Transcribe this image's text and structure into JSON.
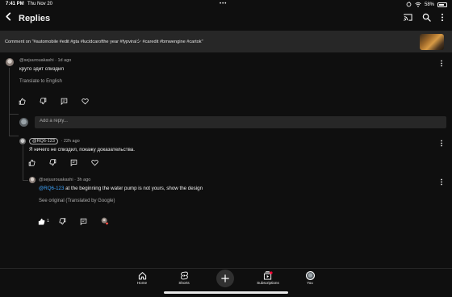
{
  "status_bar": {
    "time": "7:41 PM",
    "date": "Thu Nov 20",
    "dots": "•••",
    "battery": "58%",
    "battery_level": 0.58
  },
  "header": {
    "title": "Replies"
  },
  "comment_banner": {
    "text": "Comment on \"#automobile #edit #gta #lucidcarofthe year #fypviralシ #caredit #bmwengine #cartok\""
  },
  "comments": {
    "main": {
      "author": "@sejuurouakashi",
      "time": "1d ago",
      "text": "круто эдит спиздил",
      "translate": "Translate to English"
    },
    "reply_box": {
      "placeholder": "Add a reply..."
    },
    "reply1": {
      "author": "@RQ6-123",
      "time": "22h ago",
      "text": "Я ничего не спиздил, покажу доказательства."
    },
    "reply2": {
      "author": "@sejuurouakashi",
      "time": "3h ago",
      "mention": "@RQ6-123",
      "text": " at the beginning the water pump is not yours, show the design",
      "see_original": "See original (Translated by Google)",
      "like_count": "1"
    }
  },
  "bottom_nav": {
    "home": "Home",
    "shorts": "Shorts",
    "subscriptions": "Subscriptions",
    "you": "You"
  },
  "colors": {
    "background": "#0f0f0f",
    "surface": "#272727",
    "link": "#3ea6ff",
    "secondary_text": "#aaaaaa",
    "subscriptions_badge": "#ff0033"
  }
}
